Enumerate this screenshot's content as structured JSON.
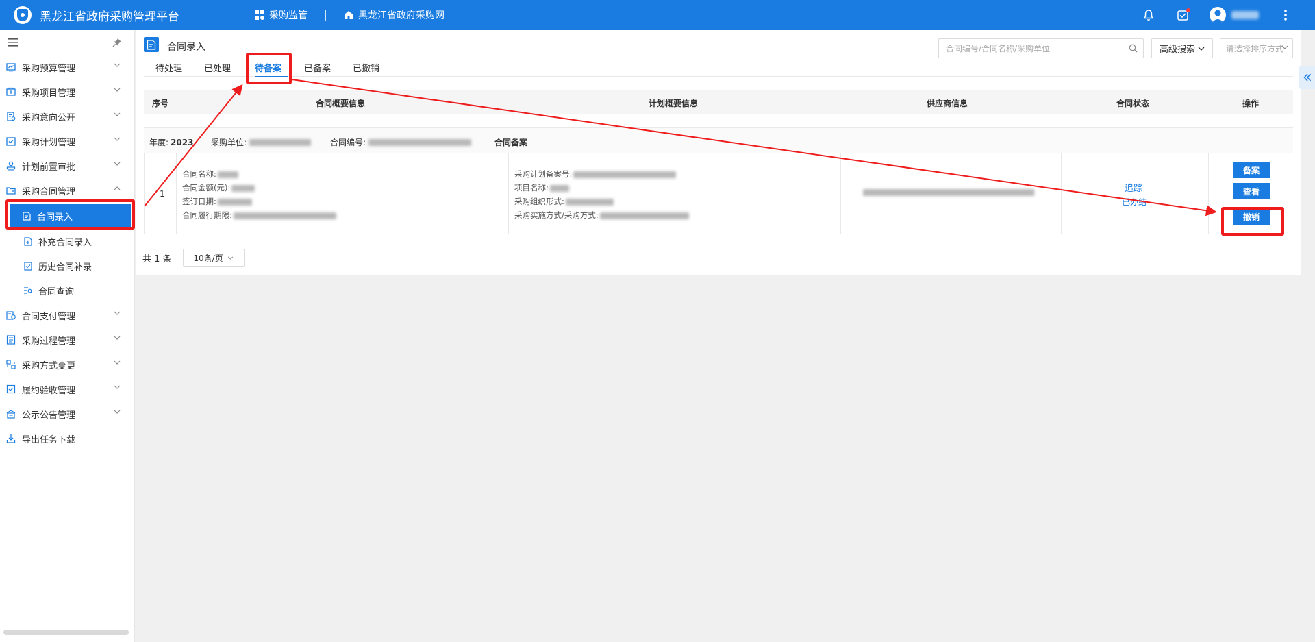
{
  "header": {
    "app_title": "黑龙江省政府采购管理平台",
    "nav": [
      {
        "label": "采购监管",
        "icon": "grid-icon"
      },
      {
        "label": "黑龙江省政府采购网",
        "icon": "home-icon"
      }
    ],
    "icons": [
      "bell-icon",
      "task-check-icon",
      "user-avatar-icon",
      "more-vertical-icon"
    ]
  },
  "sidebar": {
    "items": [
      {
        "label": "采购预算管理",
        "icon": "budget-icon"
      },
      {
        "label": "采购项目管理",
        "icon": "project-icon"
      },
      {
        "label": "采购意向公开",
        "icon": "intention-icon"
      },
      {
        "label": "采购计划管理",
        "icon": "plan-icon"
      },
      {
        "label": "计划前置审批",
        "icon": "approval-icon"
      },
      {
        "label": "采购合同管理",
        "icon": "contract-icon"
      },
      {
        "label": "合同支付管理",
        "icon": "payment-icon"
      },
      {
        "label": "采购过程管理",
        "icon": "process-icon"
      },
      {
        "label": "采购方式变更",
        "icon": "change-icon"
      },
      {
        "label": "履约验收管理",
        "icon": "acceptance-icon"
      },
      {
        "label": "公示公告管理",
        "icon": "notice-icon"
      },
      {
        "label": "导出任务下载",
        "icon": "download-icon"
      }
    ],
    "contract_sub": [
      {
        "label": "合同录入"
      },
      {
        "label": "补充合同录入"
      },
      {
        "label": "历史合同补录"
      },
      {
        "label": "合同查询"
      }
    ]
  },
  "page": {
    "title": "合同录入",
    "tabs": [
      "待处理",
      "已处理",
      "待备案",
      "已备案",
      "已撤销"
    ],
    "active_tab": "待备案",
    "search_placeholder": "合同编号/合同名称/采购单位",
    "advanced_search": "高级搜索",
    "sort_placeholder": "请选择排序方式"
  },
  "table": {
    "columns": [
      "序号",
      "合同概要信息",
      "计划概要信息",
      "供应商信息",
      "合同状态",
      "操作"
    ],
    "group": {
      "year_label": "年度:",
      "year": "2023",
      "unit_label": "采购单位:",
      "code_label": "合同编号:",
      "stage": "合同备案"
    },
    "row": {
      "index": "1",
      "contract_fields": [
        "合同名称:",
        "合同金额(元):",
        "签订日期:",
        "合同履行期限:"
      ],
      "plan_fields": [
        "采购计划备案号:",
        "项目名称:",
        "采购组织形式:",
        "采购实施方式/采购方式:"
      ],
      "status_link": "追踪",
      "status_text": "已办结",
      "actions": [
        "备案",
        "查看",
        "撤销"
      ]
    }
  },
  "pager": {
    "total": "共 1 条",
    "page_size": "10条/页"
  },
  "colors": {
    "primary": "#1a7ce0",
    "annotation": "#ee1c1c"
  }
}
